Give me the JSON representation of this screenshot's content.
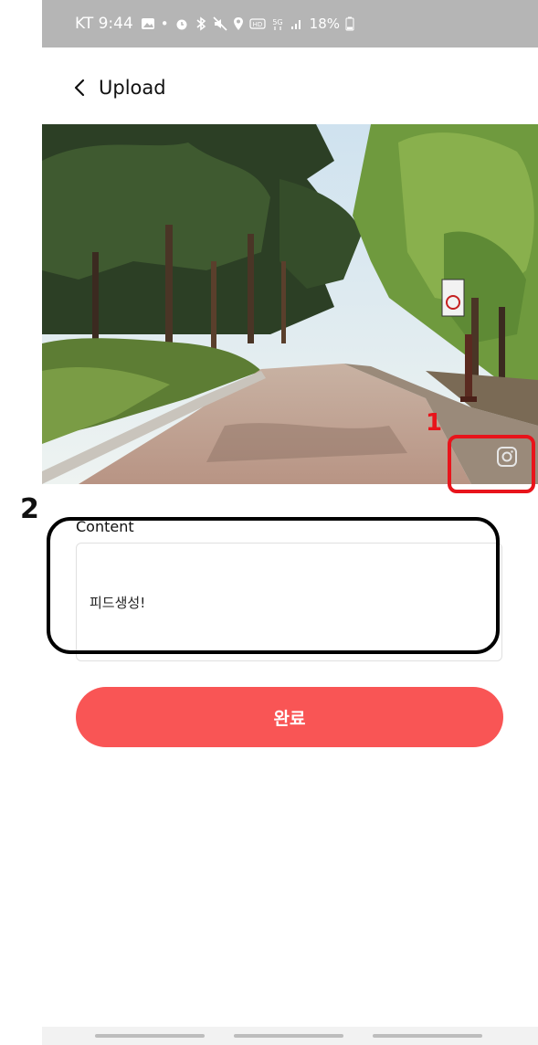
{
  "status_bar": {
    "carrier_time": "KT 9:44",
    "battery": "18%",
    "icons": [
      "gallery-icon",
      "dot-icon",
      "alarm-icon",
      "bluetooth-icon",
      "mute-icon",
      "location-icon",
      "hd-icon",
      "5g-icon",
      "signal-icon",
      "battery-icon"
    ]
  },
  "header": {
    "back_icon": "chevron-left-icon",
    "title": "Upload"
  },
  "photo": {
    "description_icon": "instagram-icon"
  },
  "form": {
    "content_label": "Content",
    "content_value": "피드생성!"
  },
  "submit_label": "완료",
  "annotations": {
    "one": "1",
    "two": "2"
  },
  "colors": {
    "status_bar": "#b5b5b5",
    "accent": "#f95555",
    "annotation_red": "#e8141b"
  }
}
